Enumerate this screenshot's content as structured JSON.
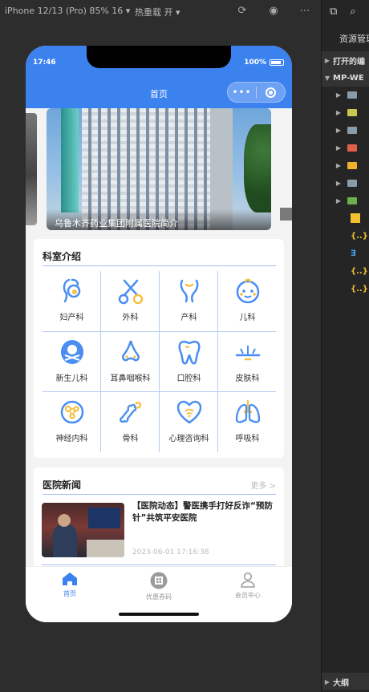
{
  "toolbar": {
    "device": "iPhone 12/13 (Pro) 85% 16 ▾",
    "hot_reload": "热重载 开 ▾"
  },
  "explorer": {
    "title": "资源管理",
    "section_open": "打开的编",
    "section_project": "MP-WE",
    "section_outline": "大纲"
  },
  "phone": {
    "status_time": "17:46",
    "battery": "100%",
    "nav_title": "首页",
    "banner_caption": "乌鲁木齐药业集团附属医院简介"
  },
  "departments": {
    "title": "科室介绍",
    "items": [
      {
        "label": "妇产科",
        "icon": "pregnancy-icon"
      },
      {
        "label": "外科",
        "icon": "scissors-icon"
      },
      {
        "label": "产科",
        "icon": "uterus-icon"
      },
      {
        "label": "儿科",
        "icon": "baby-face-icon"
      },
      {
        "label": "新生儿科",
        "icon": "newborn-icon"
      },
      {
        "label": "耳鼻咽喉科",
        "icon": "nose-icon"
      },
      {
        "label": "口腔科",
        "icon": "tooth-icon"
      },
      {
        "label": "皮肤科",
        "icon": "skin-icon"
      },
      {
        "label": "神经内科",
        "icon": "neuron-icon"
      },
      {
        "label": "骨科",
        "icon": "bone-icon"
      },
      {
        "label": "心理咨询科",
        "icon": "heart-mind-icon"
      },
      {
        "label": "呼吸科",
        "icon": "lungs-icon"
      }
    ]
  },
  "news": {
    "title": "医院新闻",
    "more": "更多 >",
    "items": [
      {
        "title": "【医院动态】警医携手打好反诈“预防针”共筑平安医院",
        "date": "2023-06-01 17:16:38"
      }
    ]
  },
  "tabbar": {
    "home": "首页",
    "coupons": "优惠券码",
    "member": "会员中心"
  },
  "colors": {
    "primary": "#3c82ef",
    "icon_blue": "#4a8ff0",
    "icon_yellow": "#f3c242"
  }
}
